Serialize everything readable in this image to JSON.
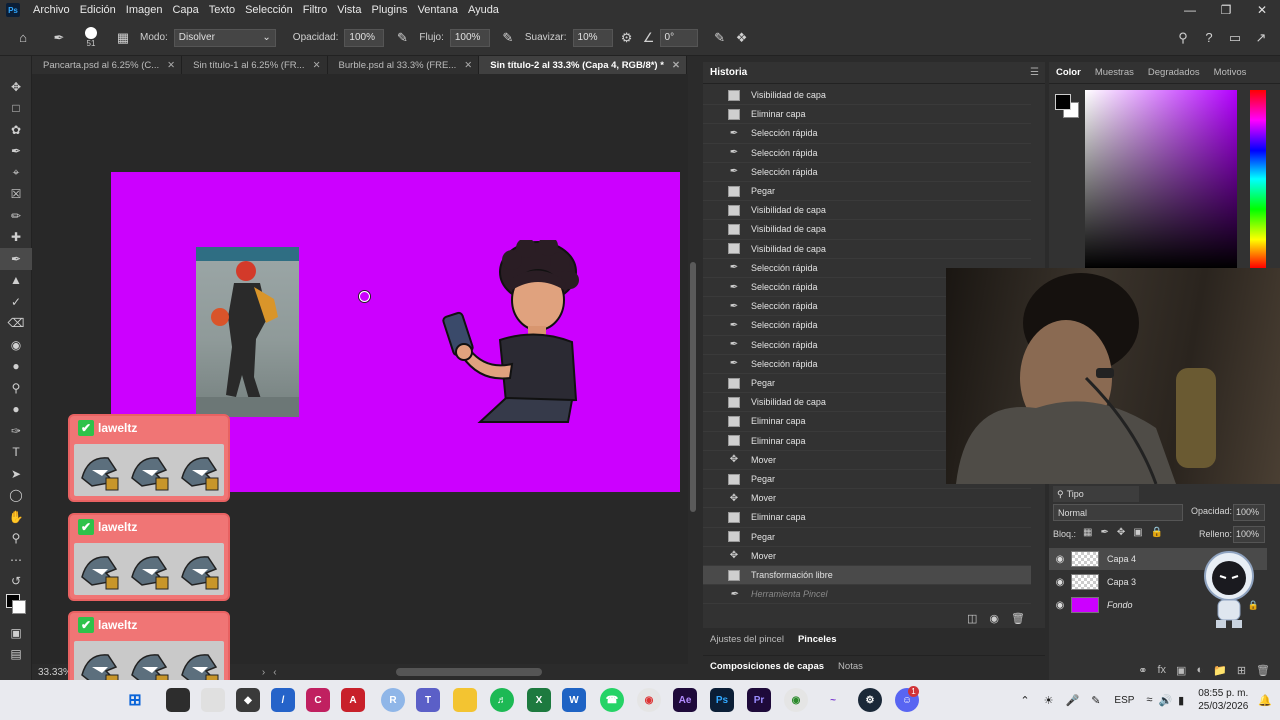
{
  "app": {
    "logo": "Ps"
  },
  "menu": [
    "Archivo",
    "Edición",
    "Imagen",
    "Capa",
    "Texto",
    "Selección",
    "Filtro",
    "Vista",
    "Plugins",
    "Ventana",
    "Ayuda"
  ],
  "options": {
    "brush_size": "51",
    "mode_label": "Modo:",
    "mode_value": "Disolver",
    "opacity_label": "Opacidad:",
    "opacity_value": "100%",
    "flow_label": "Flujo:",
    "flow_value": "100%",
    "smooth_label": "Suavizar:",
    "smooth_value": "10%",
    "angle_value": "0°"
  },
  "doc_tabs": [
    {
      "label": "Pancarta.psd al 6.25% (C..."
    },
    {
      "label": "Sin título-1 al 6.25% (FR..."
    },
    {
      "label": "Burble.psd al 33.3% (FRE..."
    },
    {
      "label": "Sin título-2 al 33.3% (Capa 4, RGB/8*) *"
    }
  ],
  "status": {
    "zoom": "33.33%"
  },
  "alerts": [
    {
      "name": "laweltz"
    },
    {
      "name": "laweltz"
    },
    {
      "name": "laweltz"
    }
  ],
  "history": {
    "title": "Historia",
    "rows": [
      {
        "label": "Visibilidad de capa",
        "icon": "doc"
      },
      {
        "label": "Eliminar capa",
        "icon": "doc"
      },
      {
        "label": "Selección rápida",
        "icon": "brush"
      },
      {
        "label": "Selección rápida",
        "icon": "brush"
      },
      {
        "label": "Selección rápida",
        "icon": "brush"
      },
      {
        "label": "Pegar",
        "icon": "doc"
      },
      {
        "label": "Visibilidad de capa",
        "icon": "doc"
      },
      {
        "label": "Visibilidad de capa",
        "icon": "doc"
      },
      {
        "label": "Visibilidad de capa",
        "icon": "doc"
      },
      {
        "label": "Selección rápida",
        "icon": "brush"
      },
      {
        "label": "Selección rápida",
        "icon": "brush"
      },
      {
        "label": "Selección rápida",
        "icon": "brush"
      },
      {
        "label": "Selección rápida",
        "icon": "brush"
      },
      {
        "label": "Selección rápida",
        "icon": "brush"
      },
      {
        "label": "Selección rápida",
        "icon": "brush"
      },
      {
        "label": "Pegar",
        "icon": "doc"
      },
      {
        "label": "Visibilidad de capa",
        "icon": "doc"
      },
      {
        "label": "Eliminar capa",
        "icon": "doc"
      },
      {
        "label": "Eliminar capa",
        "icon": "doc"
      },
      {
        "label": "Mover",
        "icon": "move"
      },
      {
        "label": "Pegar",
        "icon": "doc"
      },
      {
        "label": "Mover",
        "icon": "move"
      },
      {
        "label": "Eliminar capa",
        "icon": "doc"
      },
      {
        "label": "Pegar",
        "icon": "doc"
      },
      {
        "label": "Mover",
        "icon": "move"
      },
      {
        "label": "Transformación libre",
        "icon": "doc",
        "selected": true
      },
      {
        "label": "Herramienta Pincel",
        "icon": "brush",
        "dim": true
      }
    ]
  },
  "brush_panel": {
    "tabs": [
      "Ajustes del pincel",
      "Pinceles"
    ]
  },
  "comp_panel": {
    "tabs": [
      "Composiciones de capas",
      "Notas"
    ]
  },
  "color_panel": {
    "tabs": [
      "Color",
      "Muestras",
      "Degradados",
      "Motivos"
    ]
  },
  "layers": {
    "filter_label": "Tipo",
    "blend_mode": "Normal",
    "opacity_label": "Opacidad:",
    "opacity_value": "100%",
    "lock_label": "Bloq.:",
    "fill_label": "Relleno:",
    "fill_value": "100%",
    "items": [
      {
        "name": "Capa 4",
        "selected": true
      },
      {
        "name": "Capa 3"
      },
      {
        "name": "Fondo",
        "italic": true
      }
    ]
  },
  "taskbar": {
    "lang": "ESP",
    "time": "08:55 p. m.",
    "date": "25/03/2026",
    "notif_badge": "1"
  },
  "colors": {
    "canvas": "#cc00ff",
    "ps_blue": "#31a8ff",
    "alert_bg": "#f07575"
  }
}
